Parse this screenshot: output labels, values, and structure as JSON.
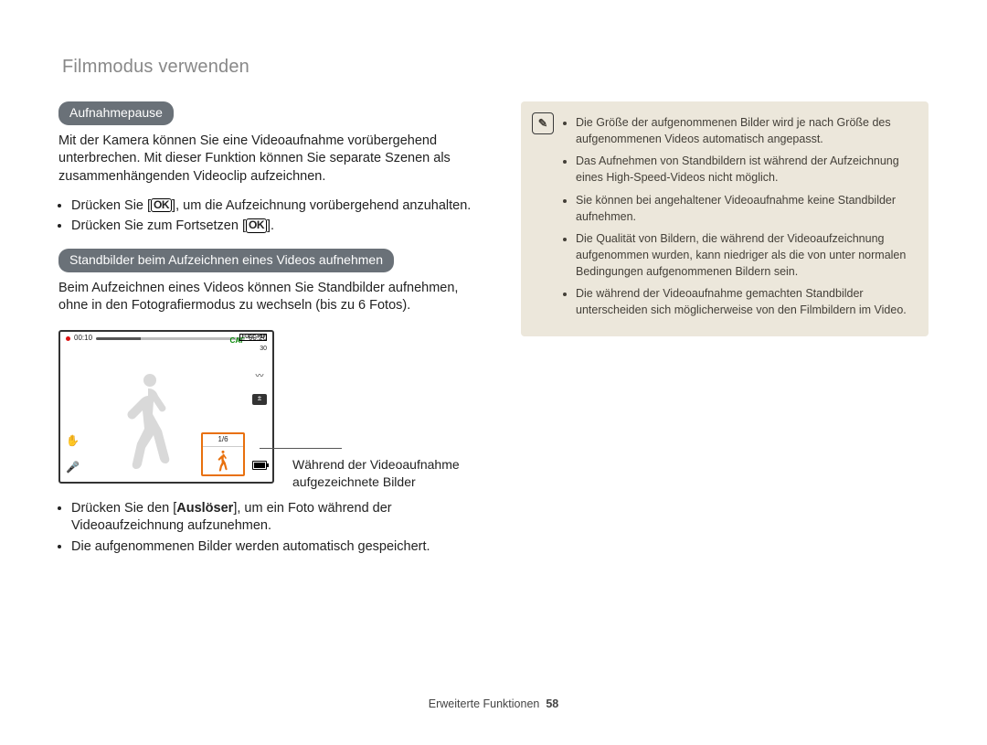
{
  "page_title": "Filmmodus verwenden",
  "footer": {
    "label": "Erweiterte Funktionen",
    "page": "58"
  },
  "left": {
    "section1": {
      "heading": "Aufnahmepause",
      "intro": "Mit der Kamera können Sie eine Videoaufnahme vorübergehend unterbrechen. Mit dieser Funktion können Sie separate Szenen als zusammenhängenden Videoclip aufzeichnen.",
      "b1_pre": "Drücken Sie [",
      "b1_post": "], um die Aufzeichnung vorübergehend anzuhalten.",
      "b2_pre": "Drücken Sie zum Fortsetzen [",
      "b2_post": "]."
    },
    "ok": "OK",
    "section2": {
      "heading": "Standbilder beim Aufzeichnen eines Videos aufnehmen",
      "intro": "Beim Aufzeichnen eines Videos können Sie Standbilder aufnehmen, ohne in den Fotografiermodus zu wechseln (bis zu 6 Fotos).",
      "fig_caption": "Während der Videoaufnahme aufgezeichnete Bilder",
      "b1_pre": "Drücken Sie den [",
      "b1_bold": "Auslöser",
      "b1_post": "], um ein Foto während der Videoaufzeichnung aufzunehmen.",
      "b2": "Die aufgenommenen Bilder werden automatisch gespeichert."
    },
    "camera": {
      "rec_time": "00:10",
      "total_time": "00:20",
      "caf": "CAF",
      "full": "FULL\nHD",
      "icon_30": "30",
      "thumb_counter": "1/6"
    }
  },
  "right": {
    "note_glyph": "✎",
    "n1": "Die Größe der aufgenommenen Bilder wird je nach Größe des aufgenommenen Videos automatisch angepasst.",
    "n2": "Das Aufnehmen von Standbildern ist während der Aufzeichnung eines High-Speed-Videos nicht möglich.",
    "n3": "Sie können bei angehaltener Videoaufnahme keine Standbilder aufnehmen.",
    "n4": "Die Qualität von Bildern, die während der Videoaufzeichnung aufgenommen wurden, kann niedriger als die von unter normalen Bedingungen aufgenommenen Bildern sein.",
    "n5": "Die während der Videoaufnahme gemachten Standbilder unterscheiden sich möglicherweise von den Filmbildern im Video."
  }
}
